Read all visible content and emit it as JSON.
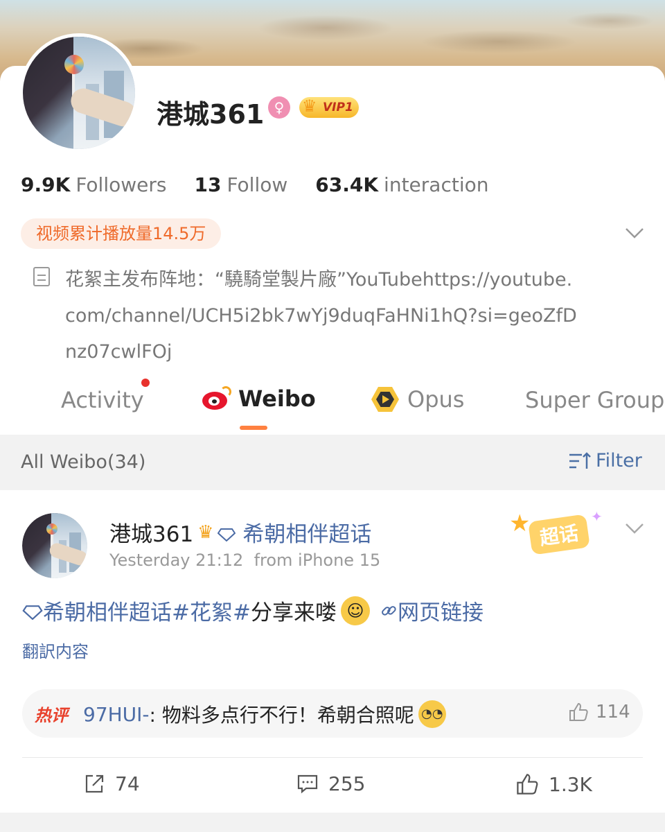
{
  "profile": {
    "name": "港城361",
    "gender_icon": "female-icon",
    "vip_label": "VIP1",
    "stats": [
      {
        "value": "9.9K",
        "label": "Followers"
      },
      {
        "value": "13",
        "label": "Follow"
      },
      {
        "value": "63.4K",
        "label": "interaction"
      }
    ],
    "play_count_badge": "视频累计播放量14.5万",
    "bio": "花絮主发布阵地：“驍騎堂製片廠”YouTubehttps://youtube.com/channel/UCH5i2bk7wYj9duqFaHNi1hQ?si=geoZfDnz07cwlFOj"
  },
  "tabs": [
    {
      "label": "Activity",
      "has_dot": true
    },
    {
      "label": "Weibo",
      "active": true
    },
    {
      "label": "Opus"
    },
    {
      "label": "Super Group"
    }
  ],
  "filter_bar": {
    "all_weibo": "All Weibo(34)",
    "filter_label": "Filter"
  },
  "post": {
    "username": "港城361",
    "topic": "希朝相伴超话",
    "time": "Yesterday 21:12",
    "source": "from iPhone 15",
    "super_badge": "超话",
    "content_topic": "希朝相伴超话",
    "content_hashtag": "#花絮#",
    "content_text": " 分享来喽",
    "content_link": "网页链接",
    "translate": "翻訳内容",
    "hot_comment": {
      "tag": "热评",
      "user": "97HUI-",
      "text": ": 物料多点行不行！希朝合照呢",
      "likes": "114"
    },
    "actions": {
      "reposts": "74",
      "comments": "255",
      "likes": "1.3K"
    }
  },
  "colors": {
    "accent_orange": "#ff8140",
    "link_blue": "#4b6ba5",
    "weibo_red": "#e6162d"
  }
}
